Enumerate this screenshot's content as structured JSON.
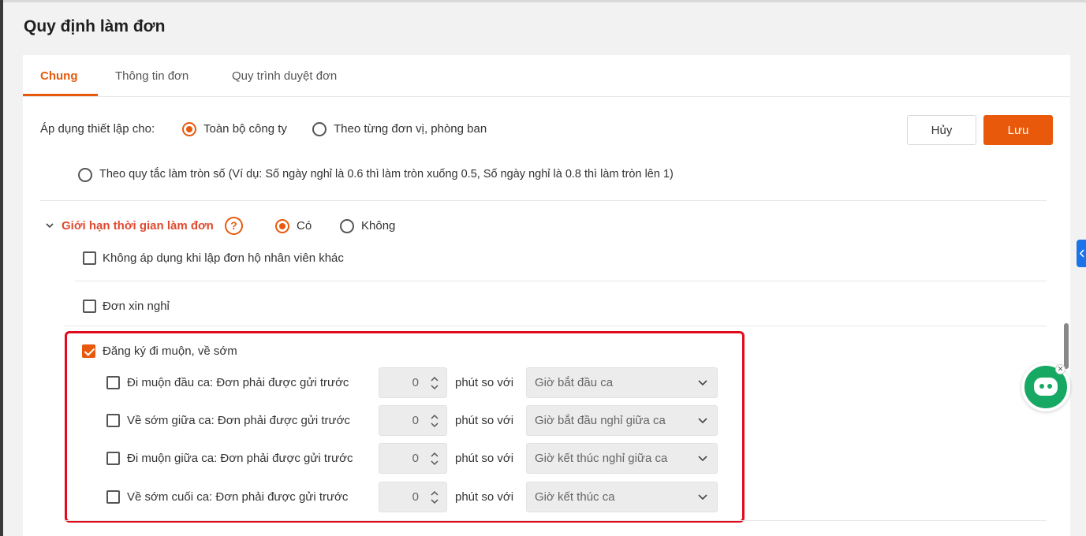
{
  "page": {
    "title": "Quy định làm đơn"
  },
  "tabs": [
    {
      "label": "Chung",
      "active": true
    },
    {
      "label": "Thông tin đơn",
      "active": false
    },
    {
      "label": "Quy trình duyệt đơn",
      "active": false
    }
  ],
  "apply": {
    "label": "Áp dụng thiết lập cho:",
    "options": [
      {
        "label": "Toàn bộ công ty",
        "selected": true
      },
      {
        "label": "Theo từng đơn vị, phòng ban",
        "selected": false
      }
    ]
  },
  "actions": {
    "cancel_label": "Hủy",
    "save_label": "Lưu"
  },
  "rounding": {
    "label": "Theo quy tắc làm tròn số (Ví dụ: Số ngày nghỉ là 0.6 thì làm tròn xuống 0.5, Số ngày nghỉ là 0.8 thì làm tròn lên 1)",
    "selected": false
  },
  "time_limit": {
    "title": "Giới hạn thời gian làm đơn",
    "help_icon": "?",
    "yes_label": "Có",
    "no_label": "Không",
    "yes_selected": true,
    "exclude_label": "Không áp dụng khi lập đơn hộ nhân viên khác",
    "exclude_checked": false,
    "leave_label": "Đơn xin nghỉ",
    "leave_checked": false,
    "late_early": {
      "label": "Đăng ký đi muộn, về sớm",
      "checked": true,
      "rows": [
        {
          "label": "Đi muộn đầu ca: Đơn phải được gửi trước",
          "value": "0",
          "unit": "phút so với",
          "ref": "Giờ bắt đầu ca",
          "checked": false
        },
        {
          "label": "Về sớm giữa ca: Đơn phải được gửi trước",
          "value": "0",
          "unit": "phút so với",
          "ref": "Giờ bắt đầu nghỉ giữa ca",
          "checked": false
        },
        {
          "label": "Đi muộn giữa ca: Đơn phải được gửi trước",
          "value": "0",
          "unit": "phút so với",
          "ref": "Giờ kết thúc nghỉ giữa ca",
          "checked": false
        },
        {
          "label": "Về sớm cuối ca: Đơn phải được gửi trước",
          "value": "0",
          "unit": "phút so với",
          "ref": "Giờ kết thúc ca",
          "checked": false
        }
      ]
    }
  },
  "colors": {
    "accent": "#e8590c",
    "section_title": "#e04a2f",
    "highlight_border": "#e00b1c",
    "chat": "#17a864",
    "side_tab": "#1a73e8"
  },
  "icons": {
    "chat": "chat-bot-icon",
    "collapse": "chevron-down-icon",
    "dropdown": "chevron-down-icon",
    "stepper": "up-down-arrows-icon",
    "side_tab": "chevron-left-icon"
  }
}
